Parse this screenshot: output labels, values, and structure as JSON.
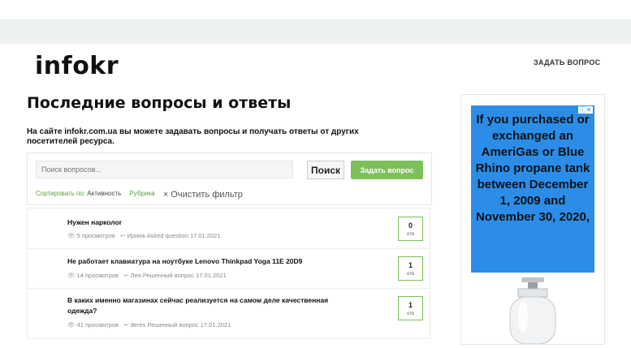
{
  "site": {
    "logo": "infokr",
    "ask_link": "ЗАДАТЬ ВОПРОС"
  },
  "main": {
    "title": "Последние вопросы и ответы",
    "intro": "На сайте infokr.com.ua вы можете задавать вопросы и получать ответы от других посетителей ресурса.",
    "search": {
      "placeholder": "Поиск вопросов...",
      "button": "Поиск",
      "ask_button": "Задать вопрос"
    },
    "filters": {
      "sort_label": "Сортировать по:",
      "sort_value": "Активность",
      "category": "Рубрика",
      "clear": "× Очистить фильтр"
    },
    "questions": [
      {
        "title": "Нужен нарколог",
        "views": "5 просмотров",
        "meta": "Ирина Asked question 17.01.2021",
        "answers": "0",
        "answers_unit": "отв"
      },
      {
        "title": "Не работает клавиатура на ноутбуке Lenovo Thinkpad Yoga 11E 20D9",
        "views": "14 просмотров",
        "meta": "Лея Решенный вопрос 17.01.2021",
        "answers": "1",
        "answers_unit": "отв"
      },
      {
        "title": "В каких именно магазинах сейчас реализуется на самом деле качественная одежда?",
        "views": "41 просмотров",
        "meta": "deres Решенный вопрос 17.01.2021",
        "answers": "1",
        "answers_unit": "отв"
      }
    ]
  },
  "ad": {
    "text": "If you purchased or exchanged an AmeriGas or Blue Rhino propane tank between December 1, 2009 and November 30, 2020,",
    "close": "ⓘ✕",
    "colors": {
      "background": "#2b8de8"
    },
    "image": "propane-tank"
  }
}
